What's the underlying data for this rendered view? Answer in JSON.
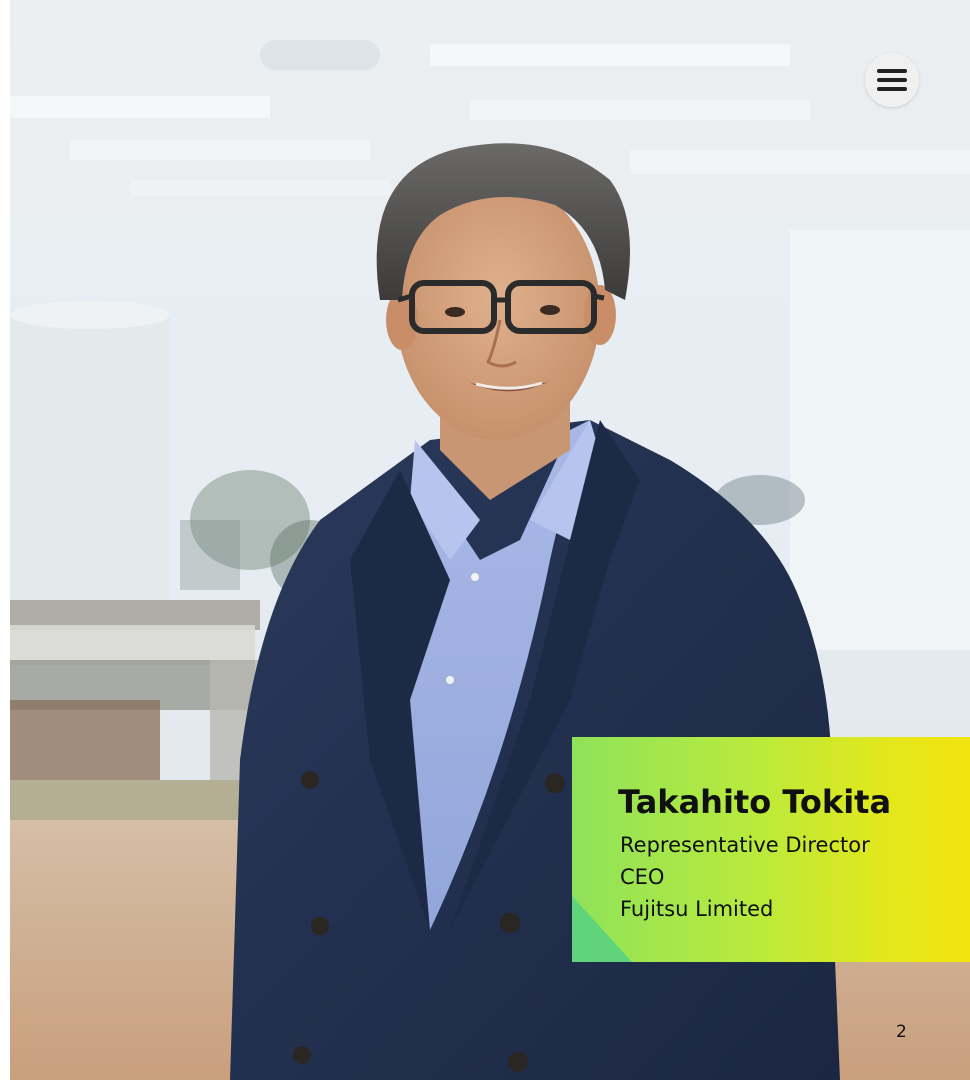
{
  "profile": {
    "name": "Takahito Tokita",
    "title_line_1": "Representative Director",
    "title_line_2": "CEO",
    "title_line_3": "Fujitsu Limited"
  },
  "page": {
    "number": "2"
  },
  "menu": {
    "icon": "hamburger-menu-icon"
  },
  "colors": {
    "card_gradient_start": "#8fe25a",
    "card_gradient_end": "#f2e30e",
    "text": "#101010"
  }
}
